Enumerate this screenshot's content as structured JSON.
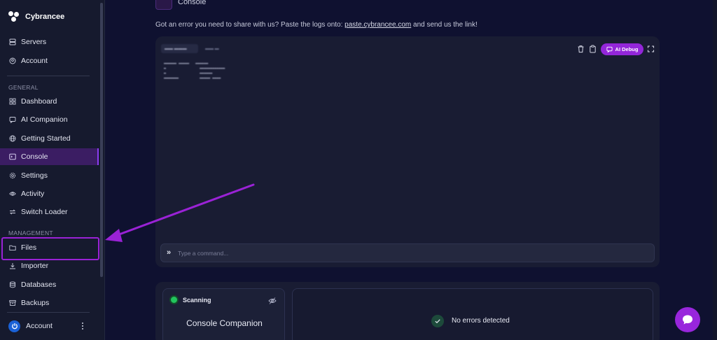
{
  "brand": {
    "name": "Cybrancee"
  },
  "sidebar": {
    "top_items": [
      {
        "label": "Servers",
        "icon": "server-icon"
      },
      {
        "label": "Account",
        "icon": "user-circle-icon"
      }
    ],
    "general_label": "GENERAL",
    "general_items": [
      {
        "label": "Dashboard",
        "icon": "grid-icon"
      },
      {
        "label": "AI Companion",
        "icon": "chat-bot-icon"
      },
      {
        "label": "Getting Started",
        "icon": "globe-icon"
      },
      {
        "label": "Console",
        "icon": "terminal-icon",
        "active": true
      },
      {
        "label": "Settings",
        "icon": "gear-icon"
      },
      {
        "label": "Activity",
        "icon": "eye-icon"
      },
      {
        "label": "Switch Loader",
        "icon": "switch-arrows-icon"
      }
    ],
    "management_label": "MANAGEMENT",
    "management_items": [
      {
        "label": "Files",
        "icon": "folder-icon"
      },
      {
        "label": "Importer",
        "icon": "download-icon"
      },
      {
        "label": "Databases",
        "icon": "database-icon"
      },
      {
        "label": "Backups",
        "icon": "archive-icon"
      }
    ],
    "account_label": "Account"
  },
  "main": {
    "title": "Console",
    "info_prefix": "Got an error you need to share with us? Paste the logs onto: ",
    "info_link": "paste.cybrancee.com",
    "info_suffix": " and send us the link!",
    "ai_debug_label": "AI Debug",
    "command_placeholder": "Type a command..."
  },
  "companion": {
    "status": "Scanning",
    "title": "Console Companion",
    "result": "No errors detected"
  },
  "colors": {
    "accent": "#9326d9",
    "active_bg": "#3b1d63",
    "success": "#22c55e"
  }
}
